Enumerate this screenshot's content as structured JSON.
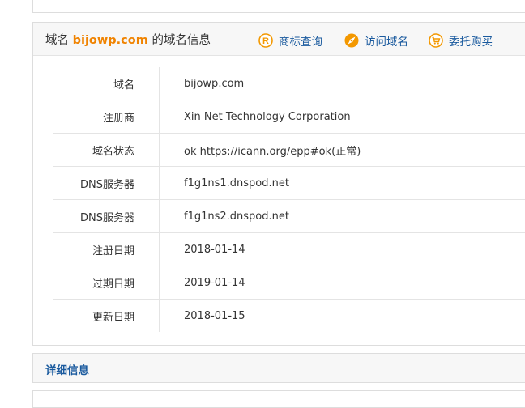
{
  "header": {
    "title_prefix": "域名 ",
    "domain": "bijowp.com",
    "title_suffix": " 的域名信息",
    "links": {
      "trademark": "商标查询",
      "visit": "访问域名",
      "buy": "委托购买"
    },
    "icon_color": "#f39800",
    "link_color": "#1a5a9e",
    "highlight_color": "#f08300"
  },
  "info_rows": [
    {
      "label": "域名",
      "value": "bijowp.com"
    },
    {
      "label": "注册商",
      "value": "Xin Net Technology Corporation"
    },
    {
      "label": "域名状态",
      "value": "ok https://icann.org/epp#ok(正常)"
    },
    {
      "label": "DNS服务器",
      "value": "f1g1ns1.dnspod.net"
    },
    {
      "label": "DNS服务器",
      "value": "f1g1ns2.dnspod.net"
    },
    {
      "label": "注册日期",
      "value": "2018-01-14"
    },
    {
      "label": "过期日期",
      "value": "2019-01-14"
    },
    {
      "label": "更新日期",
      "value": "2018-01-15"
    }
  ],
  "details": {
    "title": "详细信息"
  }
}
